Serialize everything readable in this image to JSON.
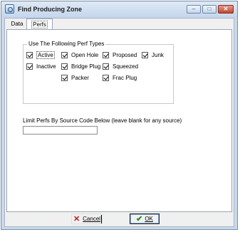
{
  "window": {
    "title": "Find Producing Zone"
  },
  "window_buttons": {
    "minimize": "–",
    "maximize": "□",
    "close": "✕"
  },
  "tabs": [
    {
      "label": "Data"
    },
    {
      "label": "Perfs"
    }
  ],
  "group": {
    "title": "Use The Following Perf Types"
  },
  "perf_types": [
    {
      "label": "Active",
      "checked": true
    },
    {
      "label": "Open Hole",
      "checked": true
    },
    {
      "label": "Proposed",
      "checked": true
    },
    {
      "label": "Junk",
      "checked": true
    },
    {
      "label": "Inactive",
      "checked": true
    },
    {
      "label": "Bridge Plug",
      "checked": true
    },
    {
      "label": "Squeezed",
      "checked": true
    },
    {
      "label": "Packer",
      "checked": true
    },
    {
      "label": "Frac Plug",
      "checked": true
    }
  ],
  "limit": {
    "label": "Limit Perfs By Source Code Below (leave blank for any source)",
    "value": ""
  },
  "buttons": {
    "cancel": "Cancel",
    "ok": "OK"
  },
  "icons": {
    "cancel": "x-icon",
    "ok": "check-icon",
    "window": "app-icon"
  }
}
